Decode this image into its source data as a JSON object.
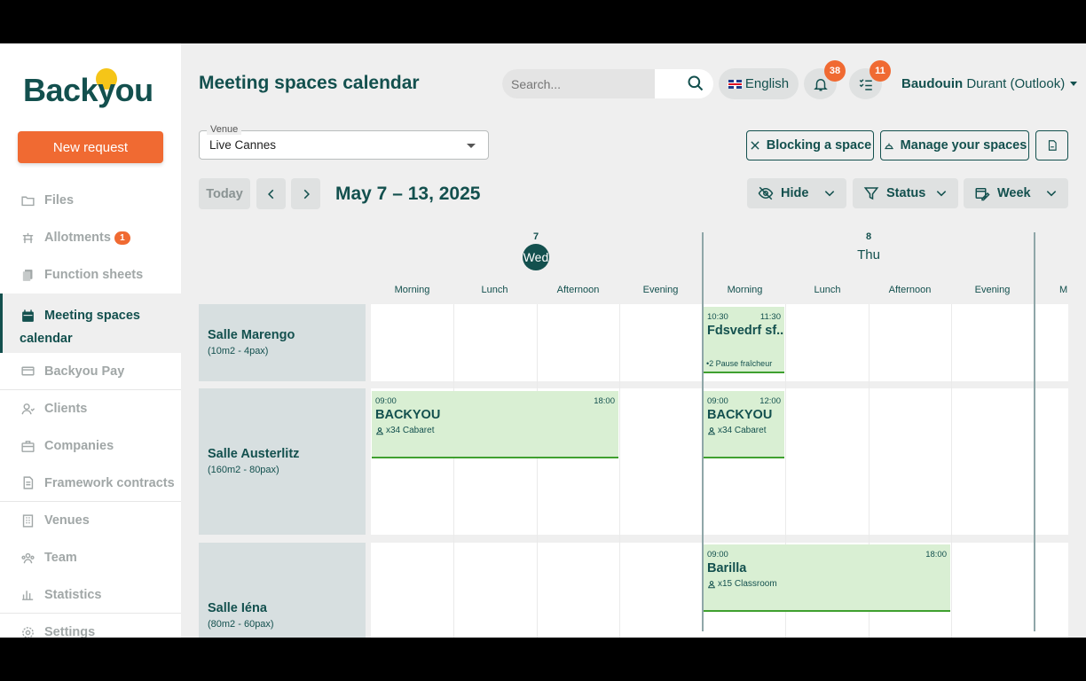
{
  "brand": {
    "logo_text": "Backyou",
    "accent": "#f06a32",
    "primary": "#13504e",
    "event_bg": "#d9efd3",
    "event_border": "#3fa02f"
  },
  "sidebar": {
    "new_request": "New request",
    "items": [
      {
        "label": "Files",
        "icon": "folder-icon"
      },
      {
        "label": "Allotments",
        "icon": "allotment-icon",
        "badge": "1"
      },
      {
        "label": "Function sheets",
        "icon": "copy-icon"
      },
      {
        "label": "Meeting spaces",
        "label2": "calendar",
        "icon": "calendar-icon",
        "active": true
      },
      {
        "label": "Backyou Pay",
        "icon": "card-icon"
      },
      {
        "label": "Clients",
        "icon": "clients-icon"
      },
      {
        "label": "Companies",
        "icon": "briefcase-icon"
      },
      {
        "label": "Framework contracts",
        "icon": "document-icon"
      },
      {
        "label": "Venues",
        "icon": "building-icon"
      },
      {
        "label": "Team",
        "icon": "team-icon"
      },
      {
        "label": "Statistics",
        "icon": "chart-icon"
      },
      {
        "label": "Settings",
        "icon": "gear-icon"
      }
    ]
  },
  "header": {
    "title": "Meeting spaces calendar",
    "search_placeholder": "Search...",
    "language": "English",
    "notifications_count": "38",
    "tasks_count": "11",
    "user_first": "Baudouin",
    "user_rest": "Durant (Outlook)"
  },
  "toolbar": {
    "venue_label": "Venue",
    "venue_value": "Live Cannes",
    "blocking": "Blocking a space",
    "manage": "Manage your spaces",
    "today": "Today",
    "date_range": "May 7 – 13, 2025",
    "hide": "Hide",
    "status": "Status",
    "view": "Week"
  },
  "calendar": {
    "days": [
      {
        "num": "7",
        "name": "Wed",
        "today": true
      },
      {
        "num": "8",
        "name": "Thu",
        "today": false
      }
    ],
    "slots": [
      "Morning",
      "Lunch",
      "Afternoon",
      "Evening"
    ],
    "next_slot_partial": "M",
    "rooms": [
      {
        "name": "Salle Marengo",
        "sub": "(10m2 - 4pax)"
      },
      {
        "name": "Salle Austerlitz",
        "sub": "(160m2 - 80pax)"
      },
      {
        "name": "Salle Iéna",
        "sub": "(80m2 - 60pax)"
      }
    ],
    "events": [
      {
        "start": "10:30",
        "end": "11:30",
        "title": "Fdsvedrf sf...",
        "note": "•2 Pause fraîcheur"
      },
      {
        "start": "09:00",
        "end": "18:00",
        "title": "BACKYOU",
        "detail": "x34 Cabaret"
      },
      {
        "start": "09:00",
        "end": "12:00",
        "title": "BACKYOU",
        "detail": "x34 Cabaret"
      },
      {
        "start": "09:00",
        "end": "18:00",
        "title": "Barilla",
        "detail": "x15 Classroom"
      }
    ]
  }
}
